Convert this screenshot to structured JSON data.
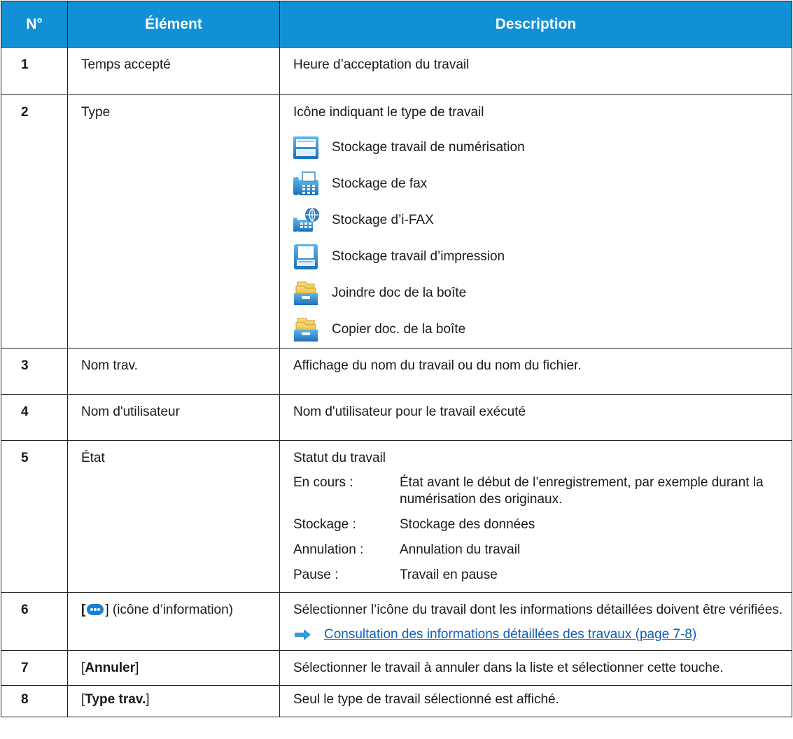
{
  "header": {
    "num": "N°",
    "element": "Élément",
    "description": "Description"
  },
  "rows": [
    {
      "num": "1",
      "element": "Temps accepté",
      "description": "Heure d’acceptation du travail"
    },
    {
      "num": "2",
      "element": "Type",
      "description": "Icône indiquant le type de travail",
      "types": [
        {
          "icon": "scan-icon",
          "label": "Stockage travail de numérisation"
        },
        {
          "icon": "fax-icon",
          "label": "Stockage de fax"
        },
        {
          "icon": "ifax-icon",
          "label": "Stockage d’i-FAX"
        },
        {
          "icon": "printer-icon",
          "label": "Stockage travail d’impression"
        },
        {
          "icon": "box-folder-icon",
          "label": "Joindre doc de la boîte"
        },
        {
          "icon": "box-folder-icon",
          "label": "Copier doc. de la boîte"
        }
      ]
    },
    {
      "num": "3",
      "element": "Nom trav.",
      "description": "Affichage du nom du travail ou du nom du fichier."
    },
    {
      "num": "4",
      "element": "Nom d'utilisateur",
      "description": "Nom d'utilisateur pour le travail exécuté"
    },
    {
      "num": "5",
      "element": "État",
      "description": "Statut du travail",
      "states": [
        {
          "key": "En cours :",
          "value": "État avant le début de l’enregistrement, par exemple durant la numérisation des originaux."
        },
        {
          "key": "Stockage :",
          "value": "Stockage des données"
        },
        {
          "key": "Annulation :",
          "value": "Annulation du travail"
        },
        {
          "key": "Pause :",
          "value": "Travail en pause"
        }
      ]
    },
    {
      "num": "6",
      "element_open": "[",
      "element_close": "] (icône d’information)",
      "description": "Sélectionner l’icône du travail dont les informations détaillées doivent être vérifiées.",
      "link": "Consultation des informations détaillées des travaux (page 7-8)"
    },
    {
      "num": "7",
      "element_open": "[",
      "element_bold": "Annuler",
      "element_close": "]",
      "description": "Sélectionner le travail à annuler dans la liste et sélectionner cette touche."
    },
    {
      "num": "8",
      "element_open": "[",
      "element_bold": "Type trav.",
      "element_close": "]",
      "description": "Seul le type de travail sélectionné est affiché."
    }
  ],
  "colors": {
    "header_bg": "#1290d6",
    "link": "#1060b8",
    "arrow": "#2c9bd8"
  }
}
